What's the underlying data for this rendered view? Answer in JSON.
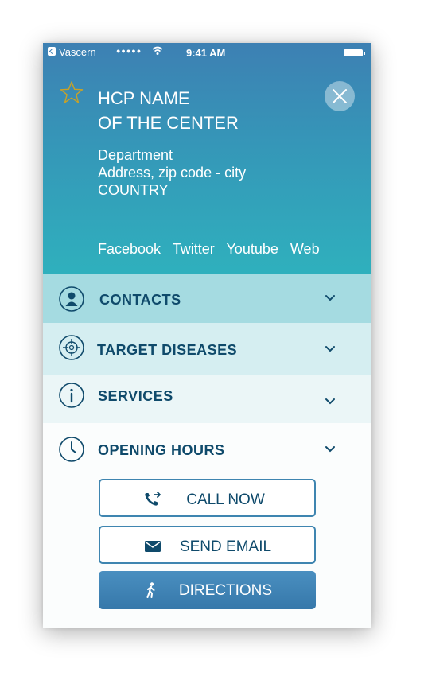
{
  "status_bar": {
    "app": "Vascern",
    "signal": "●●●●●",
    "time": "9:41 AM"
  },
  "header": {
    "title_line1": "HCP NAME",
    "title_line2": "OF THE CENTER",
    "department": "Department",
    "address": "Address, zip code - city",
    "country": "COUNTRY",
    "links": [
      "Facebook",
      "Twitter",
      "Youtube",
      "Web"
    ]
  },
  "sections": [
    {
      "label": "CONTACTS",
      "icon": "person-icon"
    },
    {
      "label": "TARGET DISEASES",
      "icon": "target-icon"
    },
    {
      "label": "SERVICES",
      "icon": "info-icon"
    },
    {
      "label": "OPENING HOURS",
      "icon": "clock-icon"
    }
  ],
  "actions": {
    "call": "CALL NOW",
    "email": "SEND EMAIL",
    "directions": "DIRECTIONS"
  },
  "colors": {
    "header_top": "#3d80b3",
    "header_bottom": "#2fb0bd",
    "text_dark": "#0f4a6b",
    "accent_blue": "#3e85b0",
    "star_gold": "#c9a227"
  }
}
